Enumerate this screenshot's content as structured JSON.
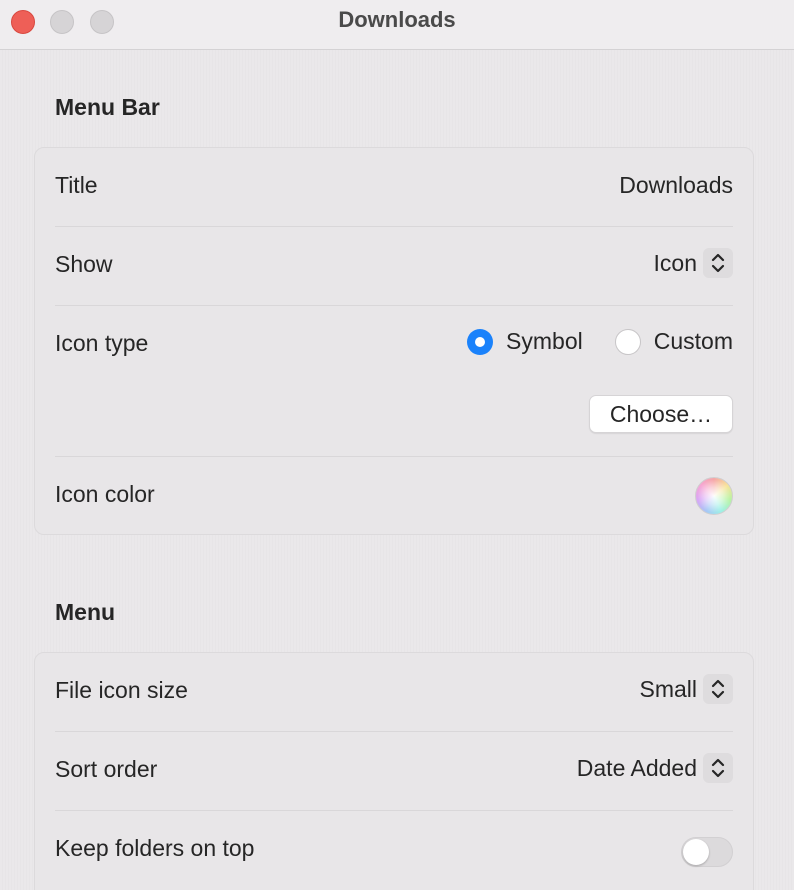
{
  "window": {
    "title": "Downloads"
  },
  "menu_bar_section": {
    "heading": "Menu Bar",
    "title_row": {
      "label": "Title",
      "placeholder": "Downloads"
    },
    "show_row": {
      "label": "Show",
      "value": "Icon"
    },
    "icon_type_row": {
      "label": "Icon type",
      "options": [
        "Symbol",
        "Custom"
      ],
      "selected": "Symbol",
      "choose_button": "Choose…"
    },
    "icon_color_row": {
      "label": "Icon color"
    }
  },
  "menu_section": {
    "heading": "Menu",
    "file_icon_size_row": {
      "label": "File icon size",
      "value": "Small"
    },
    "sort_order_row": {
      "label": "Sort order",
      "value": "Date Added"
    },
    "keep_folders_row": {
      "label": "Keep folders on top",
      "enabled": false
    }
  },
  "colors": {
    "accent": "#1a82fb",
    "close_button": "#ee5f57"
  },
  "icons": {
    "stepper": "chevron-up-down-icon",
    "color_well": "color-wheel-icon"
  }
}
